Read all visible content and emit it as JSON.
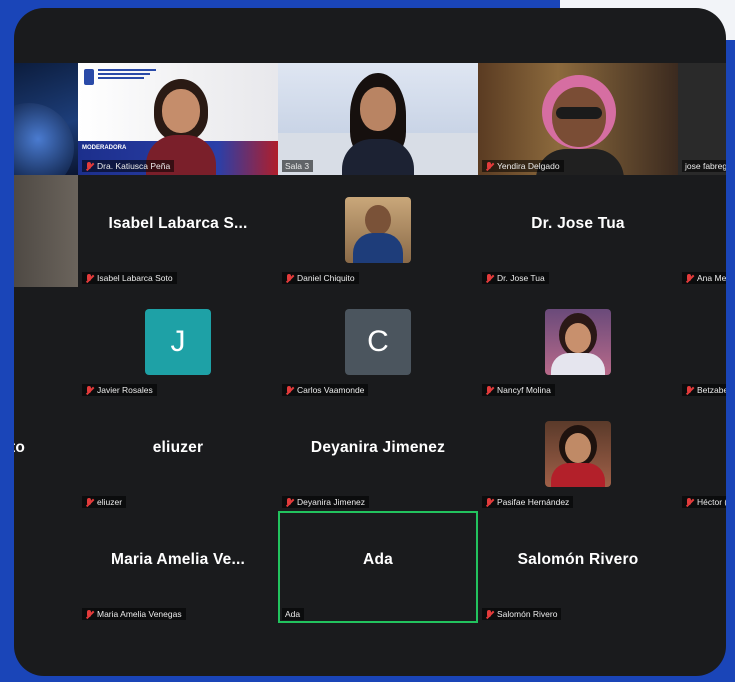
{
  "colors": {
    "accent_speaking": "#22c35e",
    "mic_muted": "#e23b3b",
    "tile_bg": "#1a1b1d",
    "avatar_j": "#1ea1a6",
    "avatar_c": "#4b555e"
  },
  "row1": {
    "moderator_banner": "MODERADORA",
    "t1_name": "Dra. Katiusca Peña",
    "t2_name": "Sala 3",
    "t3_name": "Yendira Delgado",
    "t4_name": "jose fabreg"
  },
  "row2": {
    "t1_big": "Isabel Labarca S...",
    "t1_name": "Isabel Labarca Soto",
    "t2_name": "Daniel Chiquito",
    "t3_big": "Dr. Jose Tua",
    "t3_name": "Dr. Jose Tua",
    "t4_name": "Ana Me"
  },
  "row3": {
    "t1_letter": "J",
    "t1_name": "Javier Rosales",
    "t2_letter": "C",
    "t2_name": "Carlos Vaamonde",
    "t3_name": "Nancyf Molina",
    "t4_name": "Betzabe"
  },
  "row4": {
    "t0_big": "to",
    "t1_big": "eliuzer",
    "t1_name": "eliuzer",
    "t2_big": "Deyanira Jimenez",
    "t2_name": "Deyanira Jimenez",
    "t3_name": "Pasifae Hernández",
    "t4_name": "Héctor ("
  },
  "row5": {
    "t1_big": "Maria Amelia Ve...",
    "t1_name": "Maria Amelia Venegas",
    "t2_big": "Ada",
    "t2_name": "Ada",
    "t3_big": "Salomón Rivero",
    "t3_name": "Salomón Rivero"
  }
}
